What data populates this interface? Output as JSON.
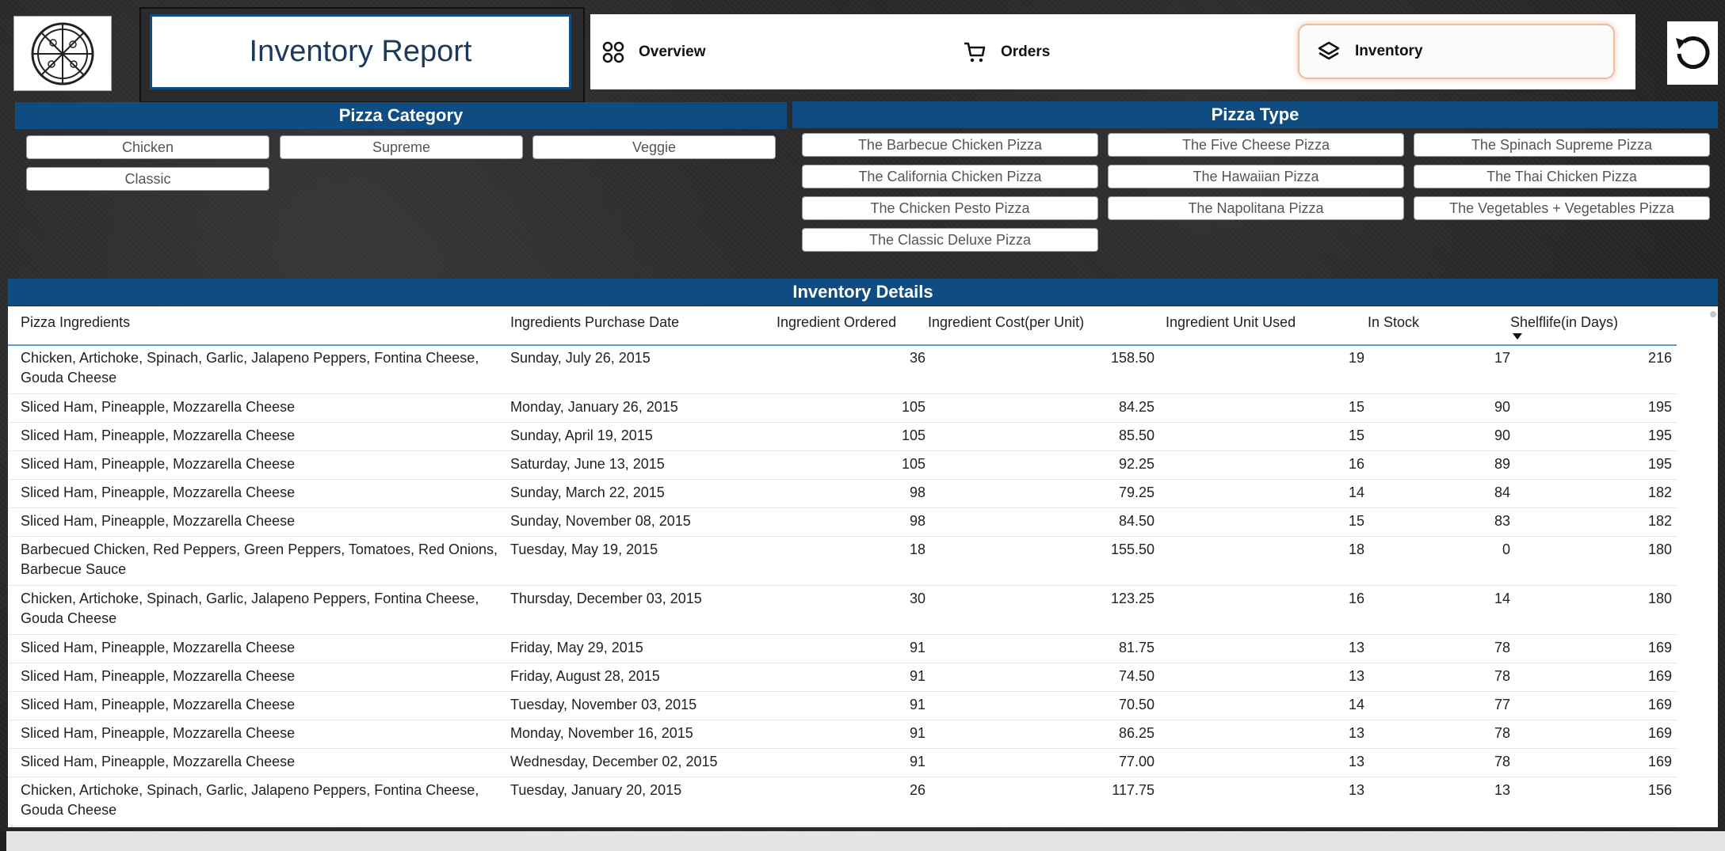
{
  "header": {
    "title": "Inventory Report",
    "nav": [
      {
        "label": "Overview",
        "icon": "grid-icon"
      },
      {
        "label": "Orders",
        "icon": "cart-icon"
      },
      {
        "label": "Inventory",
        "icon": "layers-icon",
        "active": true
      }
    ]
  },
  "pizza_category": {
    "title": "Pizza Category",
    "options": [
      "Chicken",
      "Supreme",
      "Veggie",
      "Classic"
    ]
  },
  "pizza_type": {
    "title": "Pizza Type",
    "options": [
      "The Barbecue Chicken Pizza",
      "The Five Cheese Pizza",
      "The Spinach Supreme Pizza",
      "The California Chicken Pizza",
      "The Hawaiian Pizza",
      "The Thai Chicken Pizza",
      "The Chicken Pesto Pizza",
      "The Napolitana Pizza",
      "The Vegetables + Vegetables Pizza",
      "The Classic Deluxe Pizza"
    ]
  },
  "inventory": {
    "title": "Inventory Details",
    "columns": [
      "Pizza Ingredients",
      "Ingredients Purchase Date",
      "Ingredient Ordered",
      "Ingredient Cost(per Unit)",
      "Ingredient Unit Used",
      "In Stock",
      "Shelflife(in Days)"
    ],
    "sort_column": "Shelflife(in Days)",
    "rows": [
      [
        "Chicken, Artichoke, Spinach, Garlic, Jalapeno Peppers, Fontina Cheese, Gouda Cheese",
        "Sunday, July 26, 2015",
        "36",
        "158.50",
        "19",
        "17",
        "216"
      ],
      [
        "Sliced Ham, Pineapple, Mozzarella Cheese",
        "Monday, January 26, 2015",
        "105",
        "84.25",
        "15",
        "90",
        "195"
      ],
      [
        "Sliced Ham, Pineapple, Mozzarella Cheese",
        "Sunday, April 19, 2015",
        "105",
        "85.50",
        "15",
        "90",
        "195"
      ],
      [
        "Sliced Ham, Pineapple, Mozzarella Cheese",
        "Saturday, June 13, 2015",
        "105",
        "92.25",
        "16",
        "89",
        "195"
      ],
      [
        "Sliced Ham, Pineapple, Mozzarella Cheese",
        "Sunday, March 22, 2015",
        "98",
        "79.25",
        "14",
        "84",
        "182"
      ],
      [
        "Sliced Ham, Pineapple, Mozzarella Cheese",
        "Sunday, November 08, 2015",
        "98",
        "84.50",
        "15",
        "83",
        "182"
      ],
      [
        "Barbecued Chicken, Red Peppers, Green Peppers, Tomatoes, Red Onions, Barbecue Sauce",
        "Tuesday, May 19, 2015",
        "18",
        "155.50",
        "18",
        "0",
        "180"
      ],
      [
        "Chicken, Artichoke, Spinach, Garlic, Jalapeno Peppers, Fontina Cheese, Gouda Cheese",
        "Thursday, December 03, 2015",
        "30",
        "123.25",
        "16",
        "14",
        "180"
      ],
      [
        "Sliced Ham, Pineapple, Mozzarella Cheese",
        "Friday, May 29, 2015",
        "91",
        "81.75",
        "13",
        "78",
        "169"
      ],
      [
        "Sliced Ham, Pineapple, Mozzarella Cheese",
        "Friday, August 28, 2015",
        "91",
        "74.50",
        "13",
        "78",
        "169"
      ],
      [
        "Sliced Ham, Pineapple, Mozzarella Cheese",
        "Tuesday, November 03, 2015",
        "91",
        "70.50",
        "14",
        "77",
        "169"
      ],
      [
        "Sliced Ham, Pineapple, Mozzarella Cheese",
        "Monday, November 16, 2015",
        "91",
        "86.25",
        "13",
        "78",
        "169"
      ],
      [
        "Sliced Ham, Pineapple, Mozzarella Cheese",
        "Wednesday, December 02, 2015",
        "91",
        "77.00",
        "13",
        "78",
        "169"
      ],
      [
        "Chicken, Artichoke, Spinach, Garlic, Jalapeno Peppers, Fontina Cheese, Gouda Cheese",
        "Tuesday, January 20, 2015",
        "26",
        "117.75",
        "13",
        "13",
        "156"
      ]
    ]
  },
  "colors": {
    "accent": "#0f4c81",
    "active_border": "#f0b9a0"
  }
}
